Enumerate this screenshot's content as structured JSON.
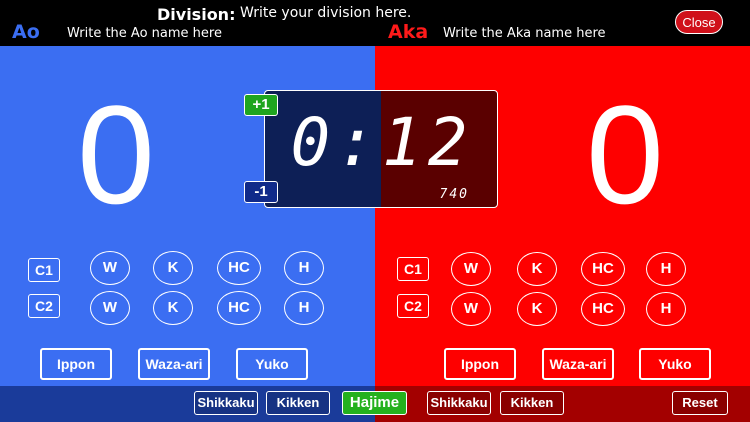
{
  "header": {
    "division_label": "Division:",
    "division_value": "Write your division here.",
    "close_label": "Close"
  },
  "ao": {
    "tag": "Ao",
    "name": "Write the Ao name here",
    "score": "0",
    "c1": "C1",
    "c2": "C2",
    "penalties_row1": [
      "W",
      "K",
      "HC",
      "H"
    ],
    "penalties_row2": [
      "W",
      "K",
      "HC",
      "H"
    ],
    "buttons": [
      "Ippon",
      "Waza-ari",
      "Yuko"
    ],
    "shikkaku": "Shikkaku",
    "kikken": "Kikken"
  },
  "aka": {
    "tag": "Aka",
    "name": "Write the Aka name here",
    "score": "0",
    "c1": "C1",
    "c2": "C2",
    "penalties_row1": [
      "W",
      "K",
      "HC",
      "H"
    ],
    "penalties_row2": [
      "W",
      "K",
      "HC",
      "H"
    ],
    "buttons": [
      "Ippon",
      "Waza-ari",
      "Yuko"
    ],
    "shikkaku": "Shikkaku",
    "kikken": "Kikken"
  },
  "timer": {
    "main": "0:12",
    "sub": "740",
    "plus_label": "+1",
    "minus_label": "-1"
  },
  "controls": {
    "hajime": "Hajime",
    "reset": "Reset"
  },
  "colors": {
    "ao_blue": "#3b6ef2",
    "aka_red": "#fe0000",
    "hajime_green": "#24b11e"
  }
}
